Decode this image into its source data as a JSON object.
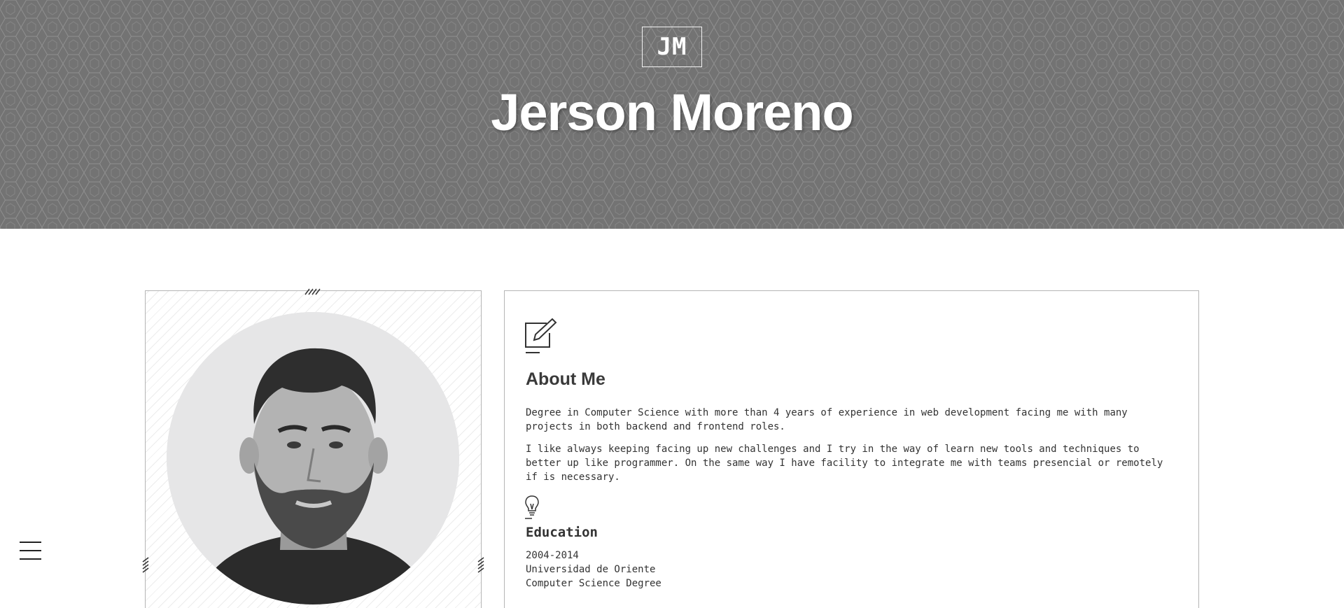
{
  "header": {
    "logo_initials": "JM",
    "name": "Jerson Moreno",
    "background_color": "#737373"
  },
  "profile": {
    "photo_icon": "portrait-photo"
  },
  "about": {
    "icon": "edit-icon",
    "title": "About Me",
    "paragraphs": [
      "Degree in Computer Science with more than 4 years of experience in web development facing me with many projects in both backend and frontend roles.",
      "I like always keeping facing up new challenges and I try in the way of learn new tools and techniques to better up like programmer. On the same way I have facility to integrate me with teams presencial or remotely if is necessary."
    ]
  },
  "education": {
    "icon": "lightbulb-icon",
    "title": "Education",
    "years": "2004-2014",
    "school": "Universidad de Oriente",
    "degree": "Computer Science Degree"
  },
  "menu": {
    "icon": "hamburger-menu-icon"
  }
}
